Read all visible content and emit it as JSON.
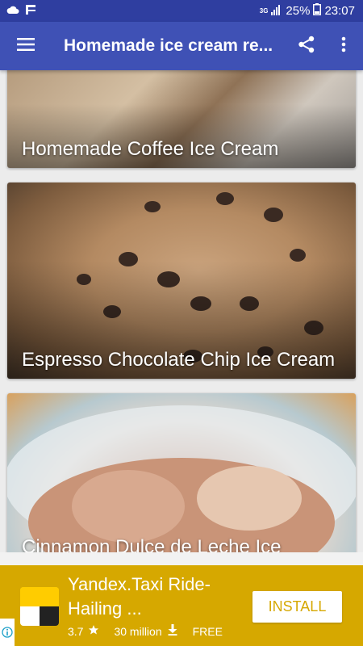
{
  "status_bar": {
    "network_type": "3G",
    "battery": "25%",
    "time": "23:07",
    "icons": [
      "cloud-icon",
      "app-f-icon",
      "signal-icon",
      "battery-icon"
    ]
  },
  "app_bar": {
    "title": "Homemade ice cream re...",
    "icons": [
      "hamburger-menu-icon",
      "share-icon",
      "more-vert-icon"
    ]
  },
  "recipes": [
    {
      "title": "Homemade Coffee Ice Cream"
    },
    {
      "title": "Espresso Chocolate Chip Ice Cream"
    },
    {
      "title": "Cinnamon Dulce de Leche Ice"
    }
  ],
  "ad": {
    "title": "Yandex.Taxi Ride-Hailing ...",
    "rating": "3.7",
    "downloads": "30 million",
    "price": "FREE",
    "install_label": "INSTALL",
    "colors": {
      "background": "#d6a800",
      "button_text": "#d6a800"
    }
  },
  "colors": {
    "app_bar": "#3f51b5",
    "status_bar": "#2f3ea0"
  }
}
